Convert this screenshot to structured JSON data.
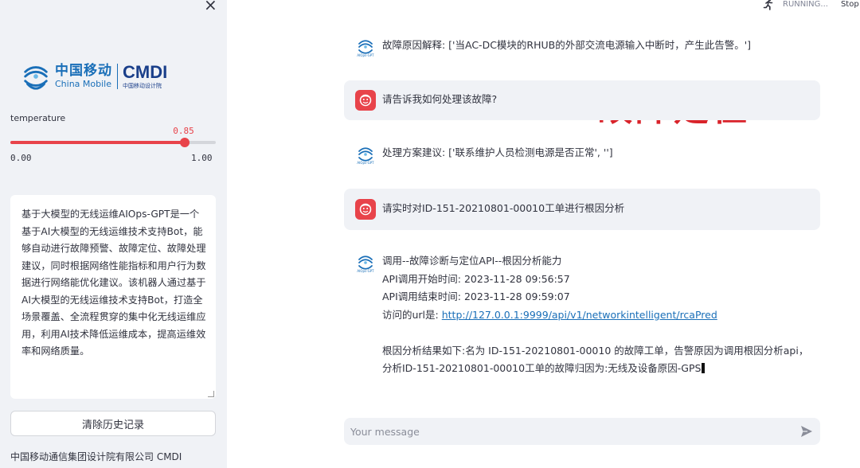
{
  "sidebar": {
    "close_symbol": "×",
    "logo": {
      "cn": "中国移动",
      "en": "China Mobile",
      "cmdi": "CMDI",
      "cmdi_sub": "中国移动设计院"
    },
    "slider": {
      "label": "temperature",
      "value": 0.85,
      "value_text": "0.85",
      "min": 0,
      "max": 1,
      "min_text": "0.00",
      "max_text": "1.00"
    },
    "description": "基于大模型的无线运维AIOps-GPT是一个基于AI大模型的无线运维技术支持Bot，能够自动进行故障预警、故障定位、故障处理建议，同时根据网络性能指标和用户行为数据进行网络能优化建议。该机器人通过基于AI大模型的无线运维技术支持Bot，打造全场景覆盖、全流程贯穿的集中化无线运维应用，利用AI技术降低运维成本，提高运维效率和网络质量。",
    "clear_button": "清除历史记录",
    "footer": "中国移动通信集团设计院有限公司 CMDI"
  },
  "status": {
    "running": "RUNNING...",
    "stop": "Stop"
  },
  "overlay_title": "故障定位",
  "messages": [
    {
      "role": "bot",
      "lines": [
        "故障原因解释: ['当AC-DC模块的RHUB的外部交流电源输入中断时，产生此告警。']"
      ]
    },
    {
      "role": "user",
      "lines": [
        "请告诉我如何处理该故障?"
      ]
    },
    {
      "role": "bot",
      "lines": [
        "处理方案建议: ['联系维护人员检测电源是否正常', '']"
      ]
    },
    {
      "role": "user",
      "lines": [
        "请实时对ID-151-20210801-00010工单进行根因分析"
      ]
    },
    {
      "role": "bot",
      "lines": [
        "调用--故障诊断与定位API--根因分析能力",
        "API调用开始时间:   2023-11-28 09:56:57",
        "API调用结束时间:   2023-11-28 09:59:07",
        "访问的url是:   ",
        "",
        "根因分析结果如下:名为 ID-151-20210801-00010 的故障工单，告警原因为调用根因分析api，",
        "分析ID-151-20210801-00010工单的故障归因为:无线及设备原因-GPS"
      ],
      "url": "http://127.0.0.1:9999/api/v1/networkintelligent/rcaPred"
    }
  ],
  "input": {
    "placeholder": "Your message"
  },
  "colors": {
    "accent": "#e8434a",
    "sidebar_bg": "#f0f2f6",
    "link": "#1a6fb8"
  }
}
